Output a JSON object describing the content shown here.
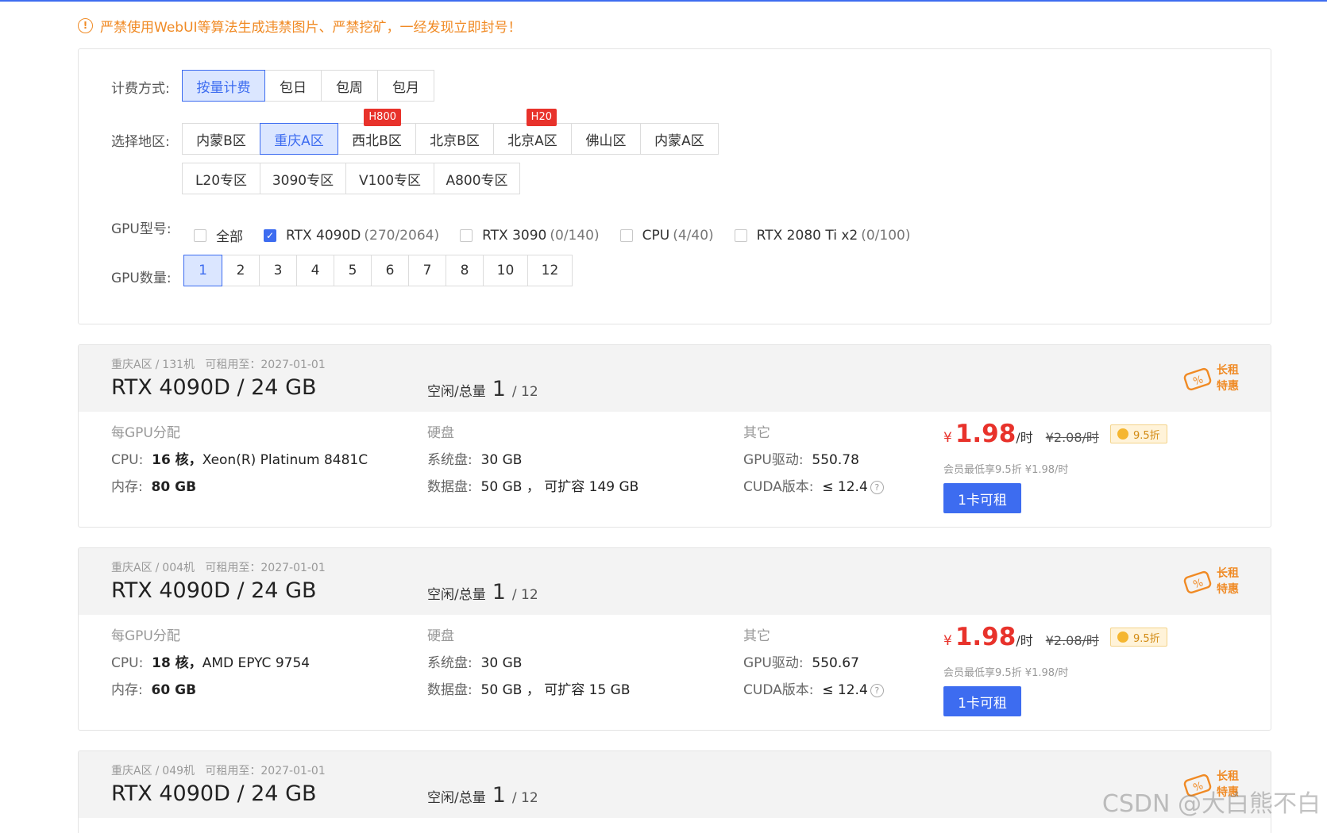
{
  "notice": "严禁使用WebUI等算法生成违禁图片、严禁挖矿，一经发现立即封号！",
  "billing": {
    "label": "计费方式:",
    "options": [
      "按量计费",
      "包日",
      "包周",
      "包月"
    ],
    "selected": "按量计费"
  },
  "region": {
    "label": "选择地区:",
    "row1": [
      {
        "name": "内蒙B区",
        "tag": ""
      },
      {
        "name": "重庆A区",
        "tag": ""
      },
      {
        "name": "西北B区",
        "tag": "H800"
      },
      {
        "name": "北京B区",
        "tag": ""
      },
      {
        "name": "北京A区",
        "tag": "H20"
      },
      {
        "name": "佛山区",
        "tag": ""
      },
      {
        "name": "内蒙A区",
        "tag": ""
      }
    ],
    "row2": [
      "L20专区",
      "3090专区",
      "V100专区",
      "A800专区"
    ],
    "selected": "重庆A区"
  },
  "gpu_type": {
    "label": "GPU型号:",
    "options": [
      {
        "name": "全部",
        "count": "",
        "checked": false
      },
      {
        "name": "RTX 4090D",
        "count": "(270/2064)",
        "checked": true
      },
      {
        "name": "RTX 3090",
        "count": "(0/140)",
        "checked": false
      },
      {
        "name": "CPU",
        "count": "(4/40)",
        "checked": false
      },
      {
        "name": "RTX 2080 Ti x2",
        "count": "(0/100)",
        "checked": false
      }
    ]
  },
  "gpu_count": {
    "label": "GPU数量:",
    "options": [
      "1",
      "2",
      "3",
      "4",
      "5",
      "6",
      "7",
      "8",
      "10",
      "12"
    ],
    "selected": "1"
  },
  "cards": [
    {
      "region": "重庆A区",
      "machine": "131机",
      "until": "可租用至：2027-01-01",
      "title": "RTX 4090D / 24 GB",
      "idle_label": "空闲/总量",
      "idle": "1",
      "total": "/ 12",
      "promo": [
        "长租",
        "特惠"
      ],
      "col1_h": "每GPU分配",
      "col2_h": "硬盘",
      "col3_h": "其它",
      "cpu_k": "CPU:",
      "cpu_cores": "16 核，",
      "cpu_model": "Xeon(R) Platinum 8481C",
      "mem_k": "内存:",
      "mem_v": "80 GB",
      "sys_k": "系统盘:",
      "sys_v": "30 GB",
      "data_k": "数据盘:",
      "data_v": "50 GB ， 可扩容 149 GB",
      "drv_k": "GPU驱动:",
      "drv_v": "550.78",
      "cuda_k": "CUDA版本:",
      "cuda_v": "≤ 12.4",
      "price_yen": "¥",
      "price": "1.98",
      "price_unit": "/时",
      "orig_price": "¥2.08/时",
      "discount": "9.5折",
      "member": "会员最低享9.5折 ¥1.98/时",
      "button": "1卡可租"
    },
    {
      "region": "重庆A区",
      "machine": "004机",
      "until": "可租用至：2027-01-01",
      "title": "RTX 4090D / 24 GB",
      "idle_label": "空闲/总量",
      "idle": "1",
      "total": "/ 12",
      "promo": [
        "长租",
        "特惠"
      ],
      "col1_h": "每GPU分配",
      "col2_h": "硬盘",
      "col3_h": "其它",
      "cpu_k": "CPU:",
      "cpu_cores": "18 核，",
      "cpu_model": "AMD EPYC 9754",
      "mem_k": "内存:",
      "mem_v": "60 GB",
      "sys_k": "系统盘:",
      "sys_v": "30 GB",
      "data_k": "数据盘:",
      "data_v": "50 GB ， 可扩容 15 GB",
      "drv_k": "GPU驱动:",
      "drv_v": "550.67",
      "cuda_k": "CUDA版本:",
      "cuda_v": "≤ 12.4",
      "price_yen": "¥",
      "price": "1.98",
      "price_unit": "/时",
      "orig_price": "¥2.08/时",
      "discount": "9.5折",
      "member": "会员最低享9.5折 ¥1.98/时",
      "button": "1卡可租"
    },
    {
      "region": "重庆A区",
      "machine": "049机",
      "until": "可租用至：2027-01-01",
      "title": "RTX 4090D / 24 GB",
      "idle_label": "空闲/总量",
      "idle": "1",
      "total": "/ 12",
      "promo": [
        "长租",
        "特惠"
      ]
    }
  ],
  "watermark": "CSDN @大白熊不白"
}
